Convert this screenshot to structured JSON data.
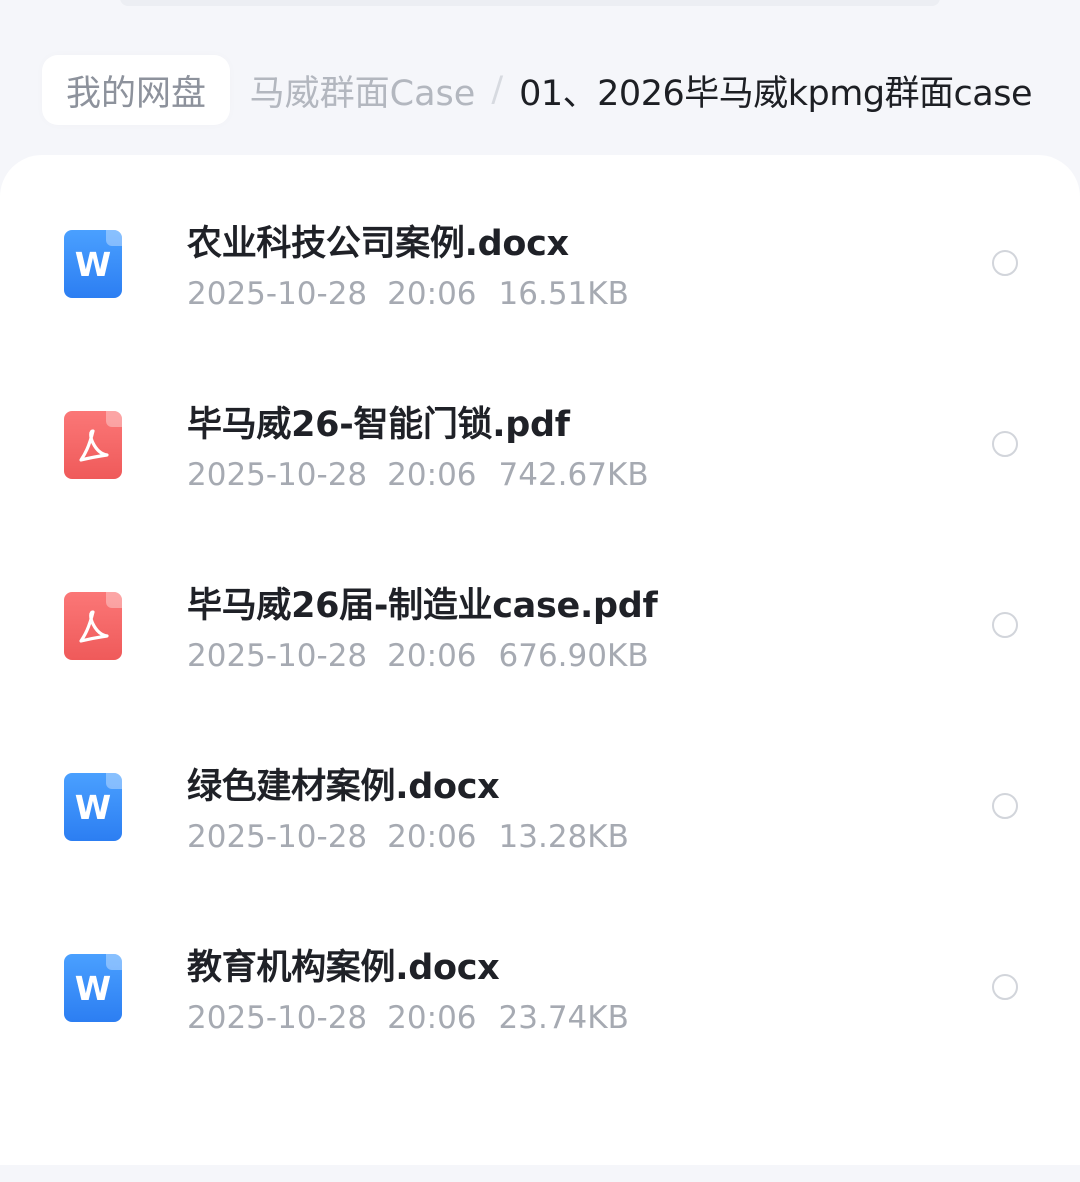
{
  "breadcrumb": {
    "root": "我的网盘",
    "middle": "马威群面Case",
    "separator": "/",
    "current": "01、2026毕马威kpmg群面case"
  },
  "files": [
    {
      "name": "农业科技公司案例.docx",
      "date": "2025-10-28",
      "time": "20:06",
      "size": "16.51KB",
      "type": "word",
      "icon": "word-doc-icon"
    },
    {
      "name": "毕马威26-智能门锁.pdf",
      "date": "2025-10-28",
      "time": "20:06",
      "size": "742.67KB",
      "type": "pdf",
      "icon": "pdf-doc-icon"
    },
    {
      "name": "毕马威26届-制造业case.pdf",
      "date": "2025-10-28",
      "time": "20:06",
      "size": "676.90KB",
      "type": "pdf",
      "icon": "pdf-doc-icon"
    },
    {
      "name": "绿色建材案例.docx",
      "date": "2025-10-28",
      "time": "20:06",
      "size": "13.28KB",
      "type": "word",
      "icon": "word-doc-icon"
    },
    {
      "name": "教育机构案例.docx",
      "date": "2025-10-28",
      "time": "20:06",
      "size": "23.74KB",
      "type": "word",
      "icon": "word-doc-icon"
    }
  ],
  "colors": {
    "word_icon": "#2c7ef2",
    "pdf_icon": "#ef5a5a",
    "background": "#f5f6fa",
    "panel": "#ffffff"
  }
}
